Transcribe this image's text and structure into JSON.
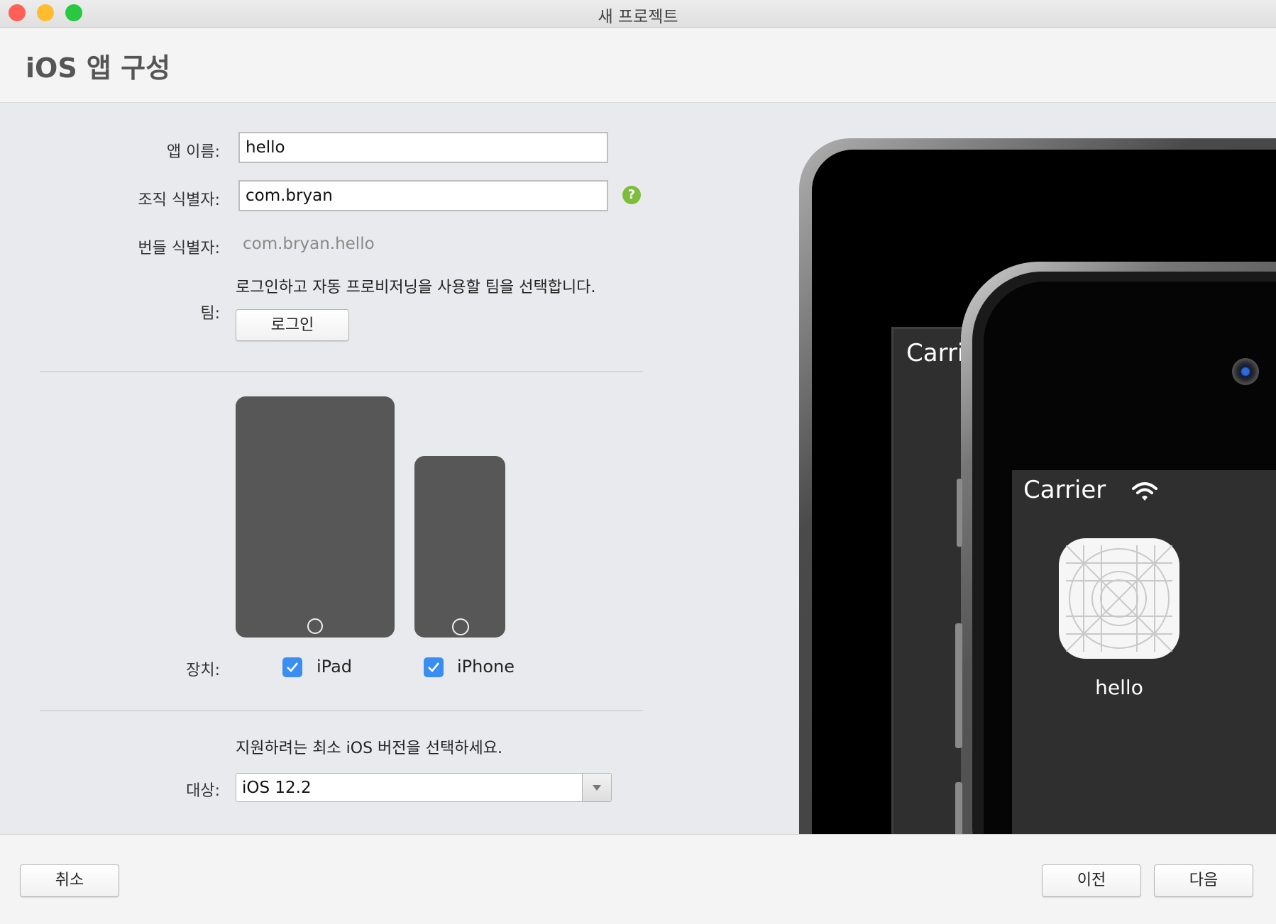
{
  "window": {
    "title": "새 프로젝트",
    "traffic_lights": {
      "close_color": "#ff5f57",
      "minimize_color": "#febc2e",
      "zoom_color": "#28c840"
    }
  },
  "header": {
    "title": "iOS 앱 구성"
  },
  "form": {
    "app_name": {
      "label": "앱 이름:",
      "value": "hello"
    },
    "org_id": {
      "label": "조직 식별자:",
      "value": "com.bryan",
      "help_icon": "question-icon",
      "help_glyph": "?"
    },
    "bundle_id": {
      "label": "번들 식별자:",
      "value": "com.bryan.hello"
    },
    "team": {
      "label": "팀:",
      "description": "로그인하고 자동 프로비저닝을 사용할 팀을 선택합니다.",
      "login_button": "로그인"
    },
    "devices": {
      "label": "장치:",
      "items": [
        {
          "name": "iPad",
          "checked": true
        },
        {
          "name": "iPhone",
          "checked": true
        }
      ]
    },
    "target": {
      "description": "지원하려는 최소 iOS 버전을 선택하세요.",
      "label": "대상:",
      "selected": "iOS 12.2"
    }
  },
  "preview": {
    "ipad_status": "Carrie",
    "iphone_status": "Carrier",
    "app_icon_label": "hello"
  },
  "footer": {
    "cancel": "취소",
    "previous": "이전",
    "next": "다음"
  },
  "colors": {
    "accent": "#3a8ef2",
    "help": "#7cbd3b"
  }
}
